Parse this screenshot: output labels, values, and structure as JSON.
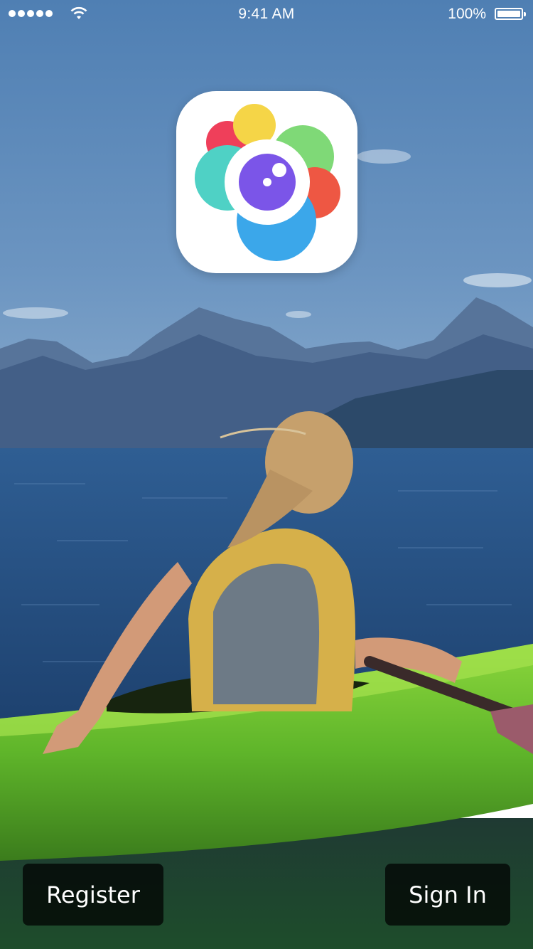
{
  "status_bar": {
    "time": "9:41 AM",
    "battery": "100%",
    "signal_icon": "signal-dots-icon",
    "wifi_icon": "wifi-icon",
    "battery_icon": "battery-icon"
  },
  "app_icon": {
    "icon": "flower-camera-logo-icon",
    "colors": [
      "#ef3f5a",
      "#f5d547",
      "#7fd977",
      "#4fd1c5",
      "#ee5743",
      "#3ba7ea",
      "#7b55e8"
    ]
  },
  "background": {
    "description_icon": "kayak-lake-mountains-photo"
  },
  "actions": {
    "register_label": "Register",
    "sign_in_label": "Sign In"
  }
}
